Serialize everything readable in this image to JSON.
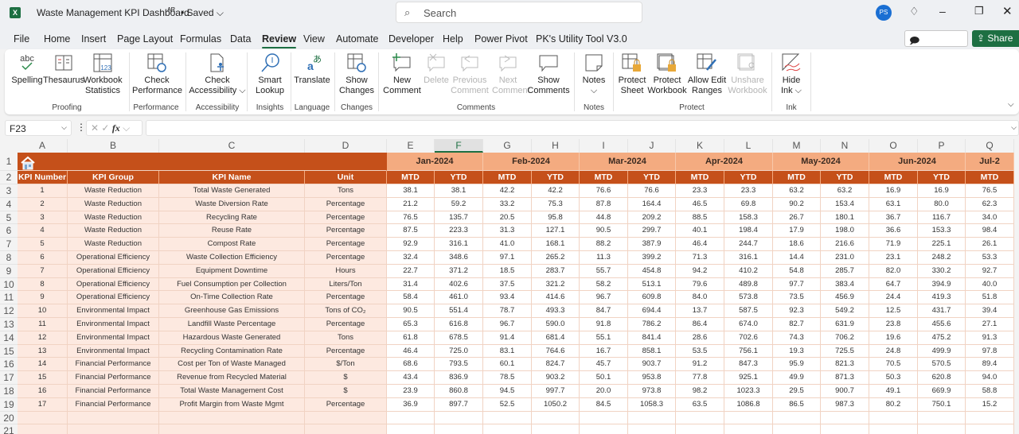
{
  "titlebar": {
    "app_icon": "excel-icon",
    "doc_title": "Waste Management KPI Dashboard",
    "share_icon": "people-icon",
    "saved_status": "• Saved ⌵",
    "search_placeholder": "Search",
    "user_initials": "PS",
    "premium_icon": "diamond-icon",
    "min": "–",
    "max": "❐",
    "close": "✕"
  },
  "menu": {
    "items": [
      "File",
      "Home",
      "Insert",
      "Page Layout",
      "Formulas",
      "Data",
      "Review",
      "View",
      "Automate",
      "Developer",
      "Help",
      "Power Pivot",
      "PK's Utility Tool V3.0"
    ],
    "active": "Review",
    "comments_btn": "🗩 Comments",
    "share_btn": "⇪ Share ⌵"
  },
  "ribbon": {
    "buttons": [
      {
        "label1": "Spelling",
        "label2": "",
        "icon": "spelling-icon",
        "enabled": true
      },
      {
        "label1": "Thesaurus",
        "label2": "",
        "icon": "thesaurus-icon",
        "enabled": true
      },
      {
        "label1": "Workbook",
        "label2": "Statistics",
        "icon": "workbook-statistics-icon",
        "enabled": true
      },
      {
        "label1": "Check",
        "label2": "Performance",
        "icon": "check-performance-icon",
        "enabled": true
      },
      {
        "label1": "Check",
        "label2": "Accessibility ⌵",
        "icon": "check-accessibility-icon",
        "enabled": true
      },
      {
        "label1": "Smart",
        "label2": "Lookup",
        "icon": "smart-lookup-icon",
        "enabled": true
      },
      {
        "label1": "Translate",
        "label2": "",
        "icon": "translate-icon",
        "enabled": true
      },
      {
        "label1": "Show",
        "label2": "Changes",
        "icon": "show-changes-icon",
        "enabled": true
      },
      {
        "label1": "New",
        "label2": "Comment",
        "icon": "new-comment-icon",
        "enabled": true
      },
      {
        "label1": "Delete",
        "label2": "",
        "icon": "delete-comment-icon",
        "enabled": false
      },
      {
        "label1": "Previous",
        "label2": "Comment",
        "icon": "previous-comment-icon",
        "enabled": false
      },
      {
        "label1": "Next",
        "label2": "Comment",
        "icon": "next-comment-icon",
        "enabled": false
      },
      {
        "label1": "Show",
        "label2": "Comments",
        "icon": "show-comments-icon",
        "enabled": true
      },
      {
        "label1": "Notes",
        "label2": "⌵",
        "icon": "notes-icon",
        "enabled": true
      },
      {
        "label1": "Protect",
        "label2": "Sheet",
        "icon": "protect-sheet-icon",
        "enabled": true
      },
      {
        "label1": "Protect",
        "label2": "Workbook",
        "icon": "protect-workbook-icon",
        "enabled": true
      },
      {
        "label1": "Allow Edit",
        "label2": "Ranges",
        "icon": "allow-edit-ranges-icon",
        "enabled": true
      },
      {
        "label1": "Unshare",
        "label2": "Workbook",
        "icon": "unshare-workbook-icon",
        "enabled": false
      },
      {
        "label1": "Hide",
        "label2": "Ink ⌵",
        "icon": "hide-ink-icon",
        "enabled": true
      }
    ],
    "groups": [
      "Proofing",
      "Performance",
      "Accessibility",
      "Insights",
      "Language",
      "Changes",
      "Comments",
      "Notes",
      "Protect",
      "Ink"
    ]
  },
  "formula_bar": {
    "name_box": "F23",
    "formula": "",
    "fx_label": "fx"
  },
  "sheet": {
    "columns": [
      "A",
      "B",
      "C",
      "D",
      "E",
      "F",
      "G",
      "H",
      "I",
      "J",
      "K",
      "L",
      "M",
      "N",
      "O",
      "P",
      "Q"
    ],
    "selected_column": "F",
    "row_numbers": [
      "1",
      "2",
      "3",
      "4",
      "5",
      "6",
      "7",
      "8",
      "9",
      "10",
      "11",
      "12",
      "13",
      "14",
      "15",
      "16",
      "17",
      "18",
      "19",
      "20",
      "21"
    ],
    "home_icon": "home-icon",
    "headers": [
      "KPI Number",
      "KPI Group",
      "KPI Name",
      "Unit"
    ],
    "months": [
      "Jan-2024",
      "Feb-2024",
      "Mar-2024",
      "Apr-2024",
      "May-2024",
      "Jun-2024",
      "Jul-2"
    ],
    "sub_headers": [
      "MTD",
      "YTD",
      "MTD",
      "YTD",
      "MTD",
      "YTD",
      "MTD",
      "YTD",
      "MTD",
      "YTD",
      "MTD",
      "YTD",
      "MTD"
    ],
    "rows": [
      {
        "num": "1",
        "group": "Waste Reduction",
        "name": "Total Waste Generated",
        "unit": "Tons",
        "vals": [
          "38.1",
          "38.1",
          "42.2",
          "42.2",
          "76.6",
          "76.6",
          "23.3",
          "23.3",
          "63.2",
          "63.2",
          "16.9",
          "16.9",
          "76.5"
        ]
      },
      {
        "num": "2",
        "group": "Waste Reduction",
        "name": "Waste Diversion Rate",
        "unit": "Percentage",
        "vals": [
          "21.2",
          "59.2",
          "33.2",
          "75.3",
          "87.8",
          "164.4",
          "46.5",
          "69.8",
          "90.2",
          "153.4",
          "63.1",
          "80.0",
          "62.3"
        ]
      },
      {
        "num": "3",
        "group": "Waste Reduction",
        "name": "Recycling Rate",
        "unit": "Percentage",
        "vals": [
          "76.5",
          "135.7",
          "20.5",
          "95.8",
          "44.8",
          "209.2",
          "88.5",
          "158.3",
          "26.7",
          "180.1",
          "36.7",
          "116.7",
          "34.0"
        ]
      },
      {
        "num": "4",
        "group": "Waste Reduction",
        "name": "Reuse Rate",
        "unit": "Percentage",
        "vals": [
          "87.5",
          "223.3",
          "31.3",
          "127.1",
          "90.5",
          "299.7",
          "40.1",
          "198.4",
          "17.9",
          "198.0",
          "36.6",
          "153.3",
          "98.4"
        ]
      },
      {
        "num": "5",
        "group": "Waste Reduction",
        "name": "Compost Rate",
        "unit": "Percentage",
        "vals": [
          "92.9",
          "316.1",
          "41.0",
          "168.1",
          "88.2",
          "387.9",
          "46.4",
          "244.7",
          "18.6",
          "216.6",
          "71.9",
          "225.1",
          "26.1"
        ]
      },
      {
        "num": "6",
        "group": "Operational Efficiency",
        "name": "Waste Collection Efficiency",
        "unit": "Percentage",
        "vals": [
          "32.4",
          "348.6",
          "97.1",
          "265.2",
          "11.3",
          "399.2",
          "71.3",
          "316.1",
          "14.4",
          "231.0",
          "23.1",
          "248.2",
          "53.3"
        ]
      },
      {
        "num": "7",
        "group": "Operational Efficiency",
        "name": "Equipment Downtime",
        "unit": "Hours",
        "vals": [
          "22.7",
          "371.2",
          "18.5",
          "283.7",
          "55.7",
          "454.8",
          "94.2",
          "410.2",
          "54.8",
          "285.7",
          "82.0",
          "330.2",
          "92.7"
        ]
      },
      {
        "num": "8",
        "group": "Operational Efficiency",
        "name": "Fuel Consumption per Collection",
        "unit": "Liters/Ton",
        "vals": [
          "31.4",
          "402.6",
          "37.5",
          "321.2",
          "58.2",
          "513.1",
          "79.6",
          "489.8",
          "97.7",
          "383.4",
          "64.7",
          "394.9",
          "40.0"
        ]
      },
      {
        "num": "9",
        "group": "Operational Efficiency",
        "name": "On-Time Collection Rate",
        "unit": "Percentage",
        "vals": [
          "58.4",
          "461.0",
          "93.4",
          "414.6",
          "96.7",
          "609.8",
          "84.0",
          "573.8",
          "73.5",
          "456.9",
          "24.4",
          "419.3",
          "51.8"
        ]
      },
      {
        "num": "10",
        "group": "Environmental Impact",
        "name": "Greenhouse Gas Emissions",
        "unit": "Tons of CO₂",
        "vals": [
          "90.5",
          "551.4",
          "78.7",
          "493.3",
          "84.7",
          "694.4",
          "13.7",
          "587.5",
          "92.3",
          "549.2",
          "12.5",
          "431.7",
          "39.4"
        ]
      },
      {
        "num": "11",
        "group": "Environmental Impact",
        "name": "Landfill Waste Percentage",
        "unit": "Percentage",
        "vals": [
          "65.3",
          "616.8",
          "96.7",
          "590.0",
          "91.8",
          "786.2",
          "86.4",
          "674.0",
          "82.7",
          "631.9",
          "23.8",
          "455.6",
          "27.1"
        ]
      },
      {
        "num": "12",
        "group": "Environmental Impact",
        "name": "Hazardous Waste Generated",
        "unit": "Tons",
        "vals": [
          "61.8",
          "678.5",
          "91.4",
          "681.4",
          "55.1",
          "841.4",
          "28.6",
          "702.6",
          "74.3",
          "706.2",
          "19.6",
          "475.2",
          "91.3"
        ]
      },
      {
        "num": "13",
        "group": "Environmental Impact",
        "name": "Recycling Contamination Rate",
        "unit": "Percentage",
        "vals": [
          "46.4",
          "725.0",
          "83.1",
          "764.6",
          "16.7",
          "858.1",
          "53.5",
          "756.1",
          "19.3",
          "725.5",
          "24.8",
          "499.9",
          "97.8"
        ]
      },
      {
        "num": "14",
        "group": "Financial Performance",
        "name": "Cost per Ton of Waste Managed",
        "unit": "$/Ton",
        "vals": [
          "68.6",
          "793.5",
          "60.1",
          "824.7",
          "45.7",
          "903.7",
          "91.2",
          "847.3",
          "95.9",
          "821.3",
          "70.5",
          "570.5",
          "89.4"
        ]
      },
      {
        "num": "15",
        "group": "Financial Performance",
        "name": "Revenue from Recycled Material",
        "unit": "$",
        "vals": [
          "43.4",
          "836.9",
          "78.5",
          "903.2",
          "50.1",
          "953.8",
          "77.8",
          "925.1",
          "49.9",
          "871.3",
          "50.3",
          "620.8",
          "94.0"
        ]
      },
      {
        "num": "16",
        "group": "Financial Performance",
        "name": "Total Waste Management Cost",
        "unit": "$",
        "vals": [
          "23.9",
          "860.8",
          "94.5",
          "997.7",
          "20.0",
          "973.8",
          "98.2",
          "1023.3",
          "29.5",
          "900.7",
          "49.1",
          "669.9",
          "58.8"
        ]
      },
      {
        "num": "17",
        "group": "Financial Performance",
        "name": "Profit Margin from Waste Mgmt",
        "unit": "Percentage",
        "vals": [
          "36.9",
          "897.7",
          "52.5",
          "1050.2",
          "84.5",
          "1058.3",
          "63.5",
          "1086.8",
          "86.5",
          "987.3",
          "80.2",
          "750.1",
          "15.2"
        ]
      }
    ]
  },
  "colors": {
    "excel_green": "#1d6f42",
    "header_dark_orange": "#c5501a",
    "header_light_orange": "#f4ab80",
    "body_left_fill": "#fde9e0"
  }
}
